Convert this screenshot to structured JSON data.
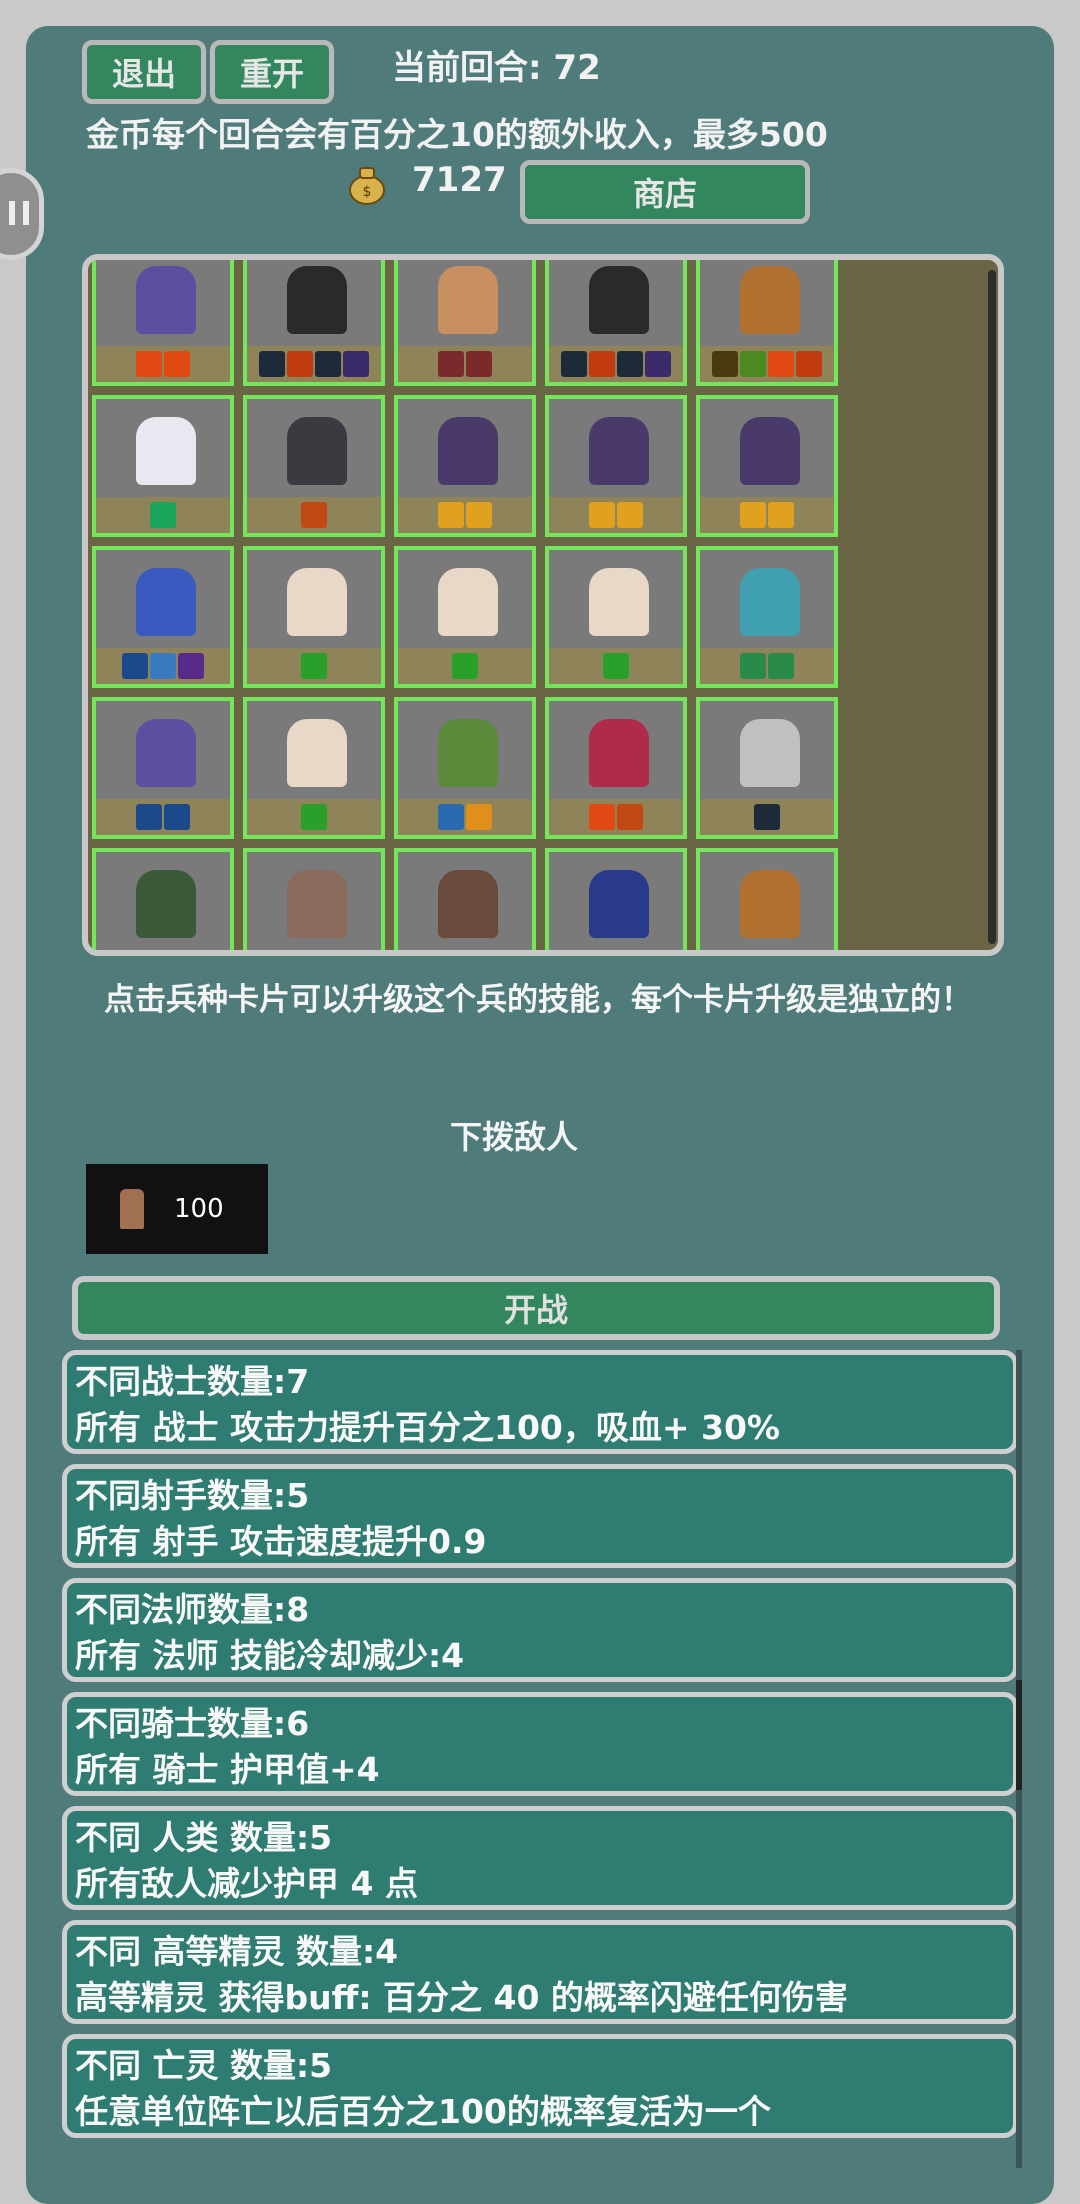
{
  "header": {
    "exit_label": "退出",
    "restart_label": "重开",
    "round_label": "当前回合: 72",
    "interest_text": "金币每个回合会有百分之10的额外收入，最多500",
    "gold_icon": "money-bag-icon",
    "gold_amount": "7127",
    "shop_label": "商店"
  },
  "colors": {
    "panel_bg": "#4f7b7b",
    "button_green": "#33875f",
    "card_border": "#74e65c",
    "buff_bg": "#2f7c72"
  },
  "grid": {
    "rows": [
      [
        {
          "unit": "wizard",
          "skills": [
            "fire-icon",
            "fire-icon"
          ]
        },
        {
          "unit": "reaper",
          "skills": [
            "shadow-icon",
            "eye-icon",
            "shadow-icon",
            "dark-icon"
          ]
        },
        {
          "unit": "barbarian",
          "skills": [
            "sword-icon",
            "sword-icon"
          ]
        },
        {
          "unit": "reaper",
          "skills": [
            "shadow-icon",
            "eye-icon",
            "shadow-icon",
            "dark-icon"
          ]
        },
        {
          "unit": "griffin",
          "skills": [
            "claw-icon",
            "leaf-icon",
            "fire-icon",
            "eye-icon"
          ]
        }
      ],
      [
        {
          "unit": "angel",
          "skills": [
            "crystal-icon"
          ]
        },
        {
          "unit": "werewolf",
          "skills": [
            "rage-icon"
          ]
        },
        {
          "unit": "mind-flayer",
          "skills": [
            "strength-icon",
            "strength-icon"
          ]
        },
        {
          "unit": "mind-flayer",
          "skills": [
            "strength-icon",
            "strength-icon"
          ]
        },
        {
          "unit": "mind-flayer",
          "skills": [
            "strength-icon",
            "strength-icon"
          ]
        }
      ],
      [
        {
          "unit": "blue-dragon",
          "skills": [
            "lightning-icon",
            "vortex-icon",
            "arcane-icon"
          ]
        },
        {
          "unit": "priest",
          "skills": [
            "heal-icon"
          ]
        },
        {
          "unit": "priest",
          "skills": [
            "heal-icon"
          ]
        },
        {
          "unit": "priest",
          "skills": [
            "heal-icon"
          ]
        },
        {
          "unit": "lich",
          "skills": [
            "skull-icon",
            "skull-icon"
          ]
        }
      ],
      [
        {
          "unit": "wizard",
          "skills": [
            "lightning-icon",
            "lightning-icon"
          ]
        },
        {
          "unit": "priest",
          "skills": [
            "heal-icon"
          ]
        },
        {
          "unit": "archer",
          "skills": [
            "arrow-icon",
            "flame-icon"
          ]
        },
        {
          "unit": "red-dragon",
          "skills": [
            "fire-icon",
            "rage-icon"
          ]
        },
        {
          "unit": "knight-fallen",
          "skills": [
            "shadow-icon"
          ]
        }
      ],
      [
        {
          "unit": "elf-ranger",
          "skills": [
            "ice-icon"
          ]
        },
        {
          "unit": "dwarf",
          "skills": []
        },
        {
          "unit": "cavalry",
          "skills": []
        },
        {
          "unit": "blue-wizard",
          "skills": [
            "ice-icon"
          ]
        },
        {
          "unit": "griffin",
          "skills": []
        }
      ]
    ]
  },
  "hint_text": "点击兵种卡片可以升级这个兵的技能，每个卡片升级是独立的！",
  "enemy_section": {
    "title": "下拨敌人",
    "enemy_icon": "caveman-icon",
    "enemy_count": "100"
  },
  "fight_label": "开战",
  "buffs": [
    {
      "title": "不同战士数量:7",
      "desc": "所有 战士 攻击力提升百分之100，吸血+ 30%"
    },
    {
      "title": "不同射手数量:5",
      "desc": "所有 射手 攻击速度提升0.9"
    },
    {
      "title": "不同法师数量:8",
      "desc": "所有 法师 技能冷却减少:4"
    },
    {
      "title": "不同骑士数量:6",
      "desc": "所有 骑士 护甲值+4"
    },
    {
      "title": "不同 人类 数量:5",
      "desc": "所有敌人减少护甲 4 点"
    },
    {
      "title": "不同 高等精灵 数量:4",
      "desc": "高等精灵 获得buff: 百分之 40 的概率闪避任何伤害"
    },
    {
      "title": "不同 亡灵 数量:5",
      "desc": "任意单位阵亡以后百分之100的概率复活为一个"
    }
  ]
}
